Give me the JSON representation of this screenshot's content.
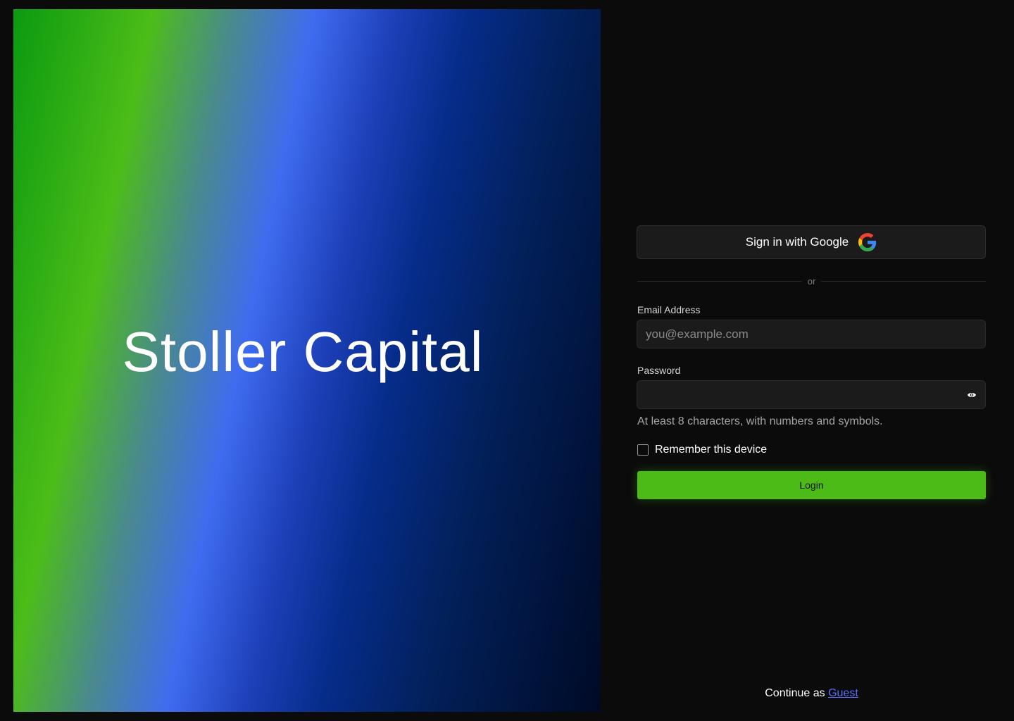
{
  "brand": {
    "title": "Stoller Capital"
  },
  "login": {
    "google_button_label": "Sign in with Google",
    "google_icon": "google-g-icon",
    "divider_text": "or",
    "email_label": "Email Address",
    "email_placeholder": "you@example.com",
    "email_value": "",
    "password_label": "Password",
    "password_value": "",
    "password_toggle_icon": "eye-icon",
    "password_hint": "At least 8 characters, with numbers and symbols.",
    "remember_label": "Remember this device",
    "remember_checked": false,
    "login_button_label": "Login"
  },
  "guest": {
    "prefix": "Continue as",
    "link_label": "Guest"
  },
  "colors": {
    "background": "#0b0b0b",
    "accent_green": "#4cbb17",
    "link_blue": "#5b6cff",
    "field_bg": "#1b1b1b"
  }
}
